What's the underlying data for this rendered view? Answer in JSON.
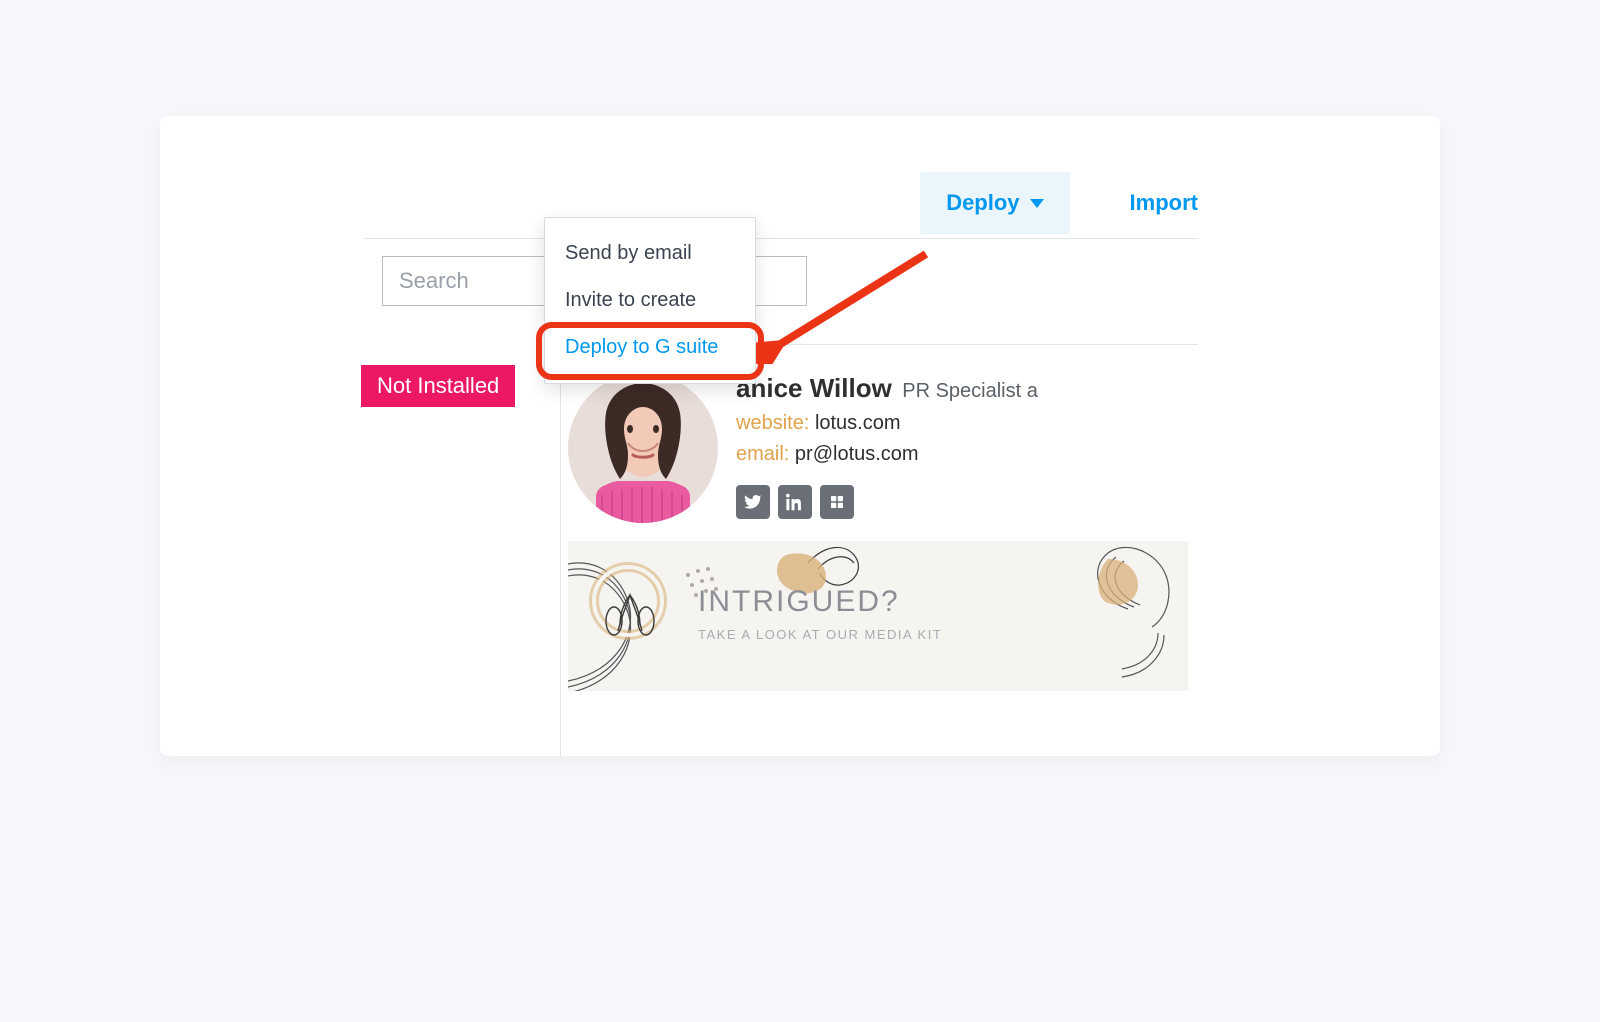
{
  "toolbar": {
    "deploy_label": "Deploy",
    "import_label": "Import"
  },
  "search": {
    "placeholder": "Search"
  },
  "status": {
    "label": "Not Installed"
  },
  "dropdown": {
    "items": [
      {
        "label": "Send by email"
      },
      {
        "label": "Invite to create"
      },
      {
        "label": "Deploy to G suite"
      }
    ]
  },
  "signature": {
    "name_partial": "anice Willow",
    "title_partial": "PR Specialist a",
    "website_label": "website:",
    "website_value": "lotus.com",
    "email_label": "email:",
    "email_value": "pr@lotus.com",
    "socials": [
      "twitter",
      "linkedin",
      "google"
    ]
  },
  "banner": {
    "title": "INTRIGUED?",
    "subtitle": "TAKE A LOOK AT OUR MEDIA KIT"
  },
  "colors": {
    "accent": "#0099ef",
    "badge": "#ec1765",
    "highlight_border": "#eb3316",
    "sig_label": "#e0a24b"
  }
}
